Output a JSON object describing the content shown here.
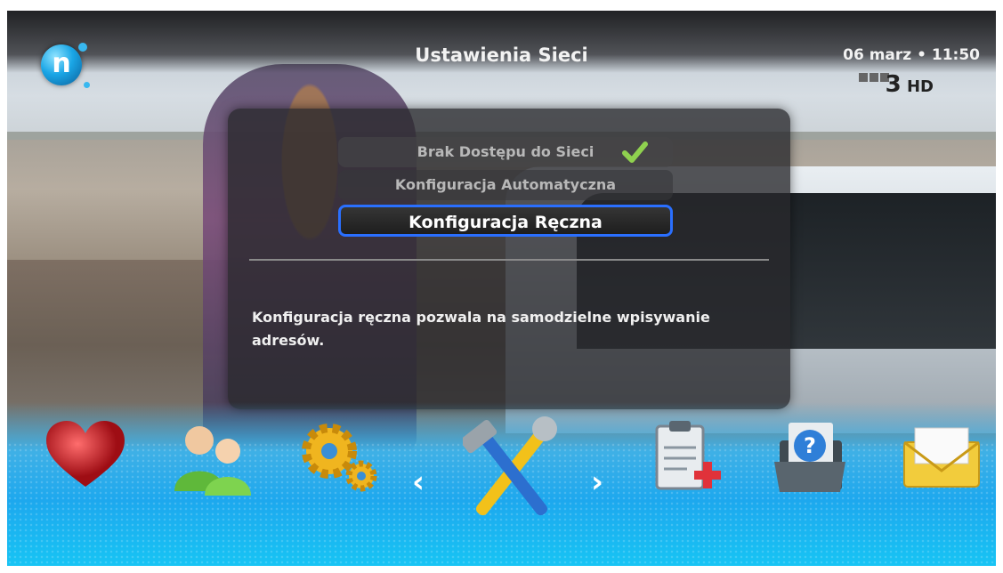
{
  "header": {
    "title": "Ustawienia Sieci",
    "datetime": "06 marz  •  11:50",
    "logo_letter": "n",
    "channel_logo": "HD",
    "channel_number": "3"
  },
  "dialog": {
    "options": [
      {
        "label": "Brak Dostępu do Sieci",
        "checked": true
      },
      {
        "label": "Konfiguracja Automatyczna",
        "checked": false
      },
      {
        "label": "Konfiguracja Ręczna",
        "selected": true
      }
    ],
    "description": "Konfiguracja ręczna pozwala na samodzielne wpisywanie adresów."
  },
  "dock": {
    "items": [
      {
        "icon": "favorites-heart-icon"
      },
      {
        "icon": "users-icon"
      },
      {
        "icon": "gears-settings-icon"
      },
      {
        "icon": "tools-wrench-hammer-icon",
        "selected": true
      },
      {
        "icon": "clipboard-medical-icon"
      },
      {
        "icon": "help-folder-icon"
      },
      {
        "icon": "mail-envelope-icon"
      }
    ],
    "left_arrow": "‹",
    "right_arrow": "›"
  },
  "colors": {
    "selection_border": "#2a6fff",
    "dock_blue": "#1da8ee",
    "check_green": "#8fd14f"
  }
}
